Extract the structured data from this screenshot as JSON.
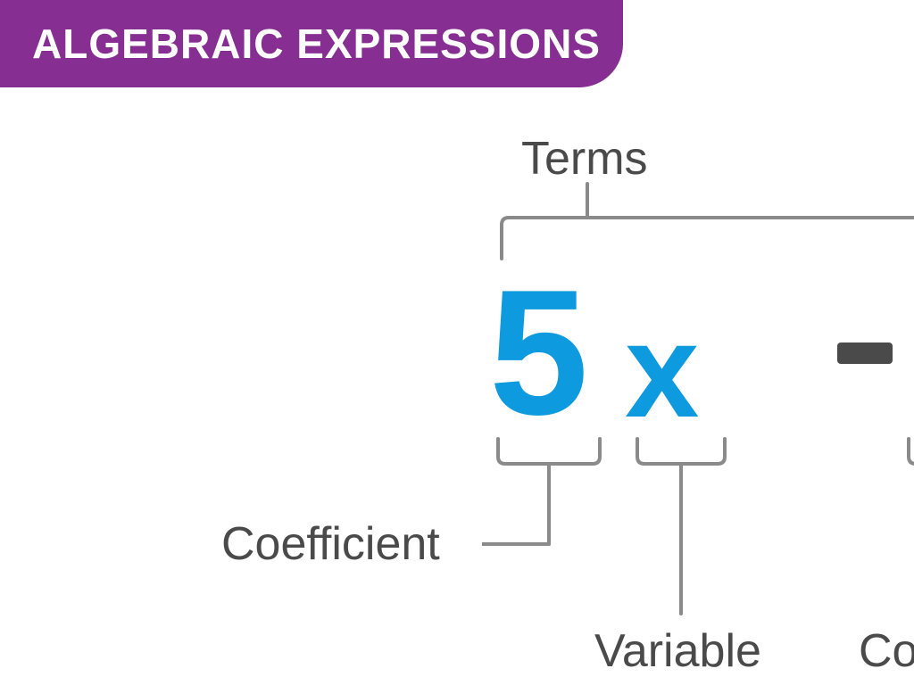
{
  "banner": {
    "title": "ALGEBRAIC EXPRESSIONS"
  },
  "labels": {
    "terms": "Terms",
    "coefficient": "Coefficient",
    "variable": "Variable",
    "constant_partial": "Co"
  },
  "expression": {
    "coefficient": "5",
    "variable": "x",
    "operator": "-"
  },
  "colors": {
    "banner": "#862e91",
    "expression": "#0e9adf",
    "text": "#4a4a4a",
    "bracket": "#8a8a8a"
  }
}
